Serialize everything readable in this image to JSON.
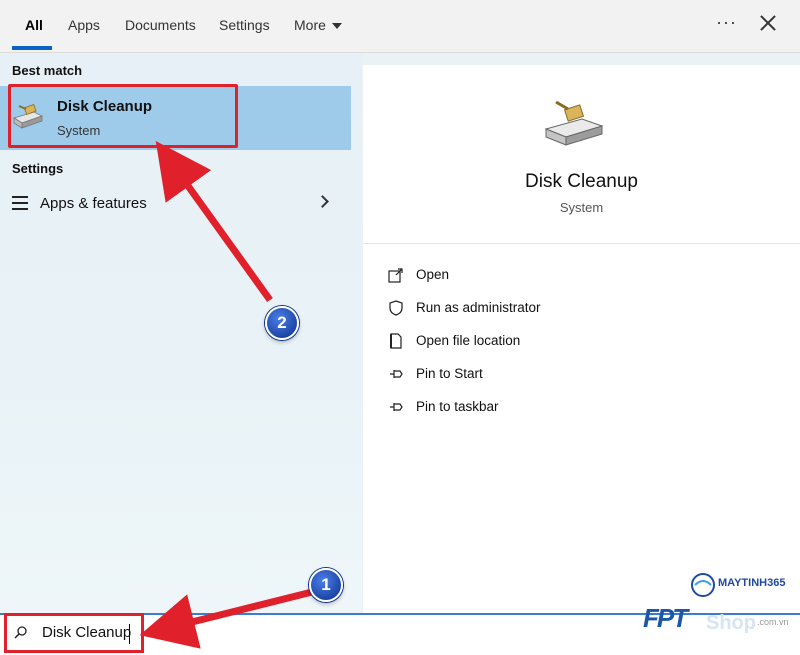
{
  "tabs": [
    {
      "label": "All",
      "active": true
    },
    {
      "label": "Apps"
    },
    {
      "label": "Documents"
    },
    {
      "label": "Settings"
    },
    {
      "label": "More"
    }
  ],
  "header": {
    "ellipsis": "···"
  },
  "left": {
    "best_match_title": "Best match",
    "best_match": {
      "title": "Disk Cleanup",
      "subtitle": "System",
      "icon": "disk-cleanup-icon"
    },
    "settings_title": "Settings",
    "settings_items": [
      {
        "label": "Apps & features",
        "icon": "list-icon"
      }
    ]
  },
  "right": {
    "app_title": "Disk Cleanup",
    "app_subtitle": "System",
    "actions": [
      {
        "label": "Open",
        "icon": "open-icon"
      },
      {
        "label": "Run as administrator",
        "icon": "shield-icon"
      },
      {
        "label": "Open file location",
        "icon": "file-location-icon"
      },
      {
        "label": "Pin to Start",
        "icon": "pin-icon"
      },
      {
        "label": "Pin to taskbar",
        "icon": "pin-icon"
      }
    ]
  },
  "search": {
    "value": "Disk Cleanup"
  },
  "annotations": {
    "badge1": "1",
    "badge2": "2",
    "arrow_color": "#e0202a"
  },
  "watermark": {
    "brand": "MAYTINH365",
    "shop": "Shop",
    "fpt": "FPT",
    "domain": ".com.vn"
  },
  "colors": {
    "accent": "#0a64c8",
    "selection": "#9fcbea",
    "highlight": "#e0202a"
  }
}
